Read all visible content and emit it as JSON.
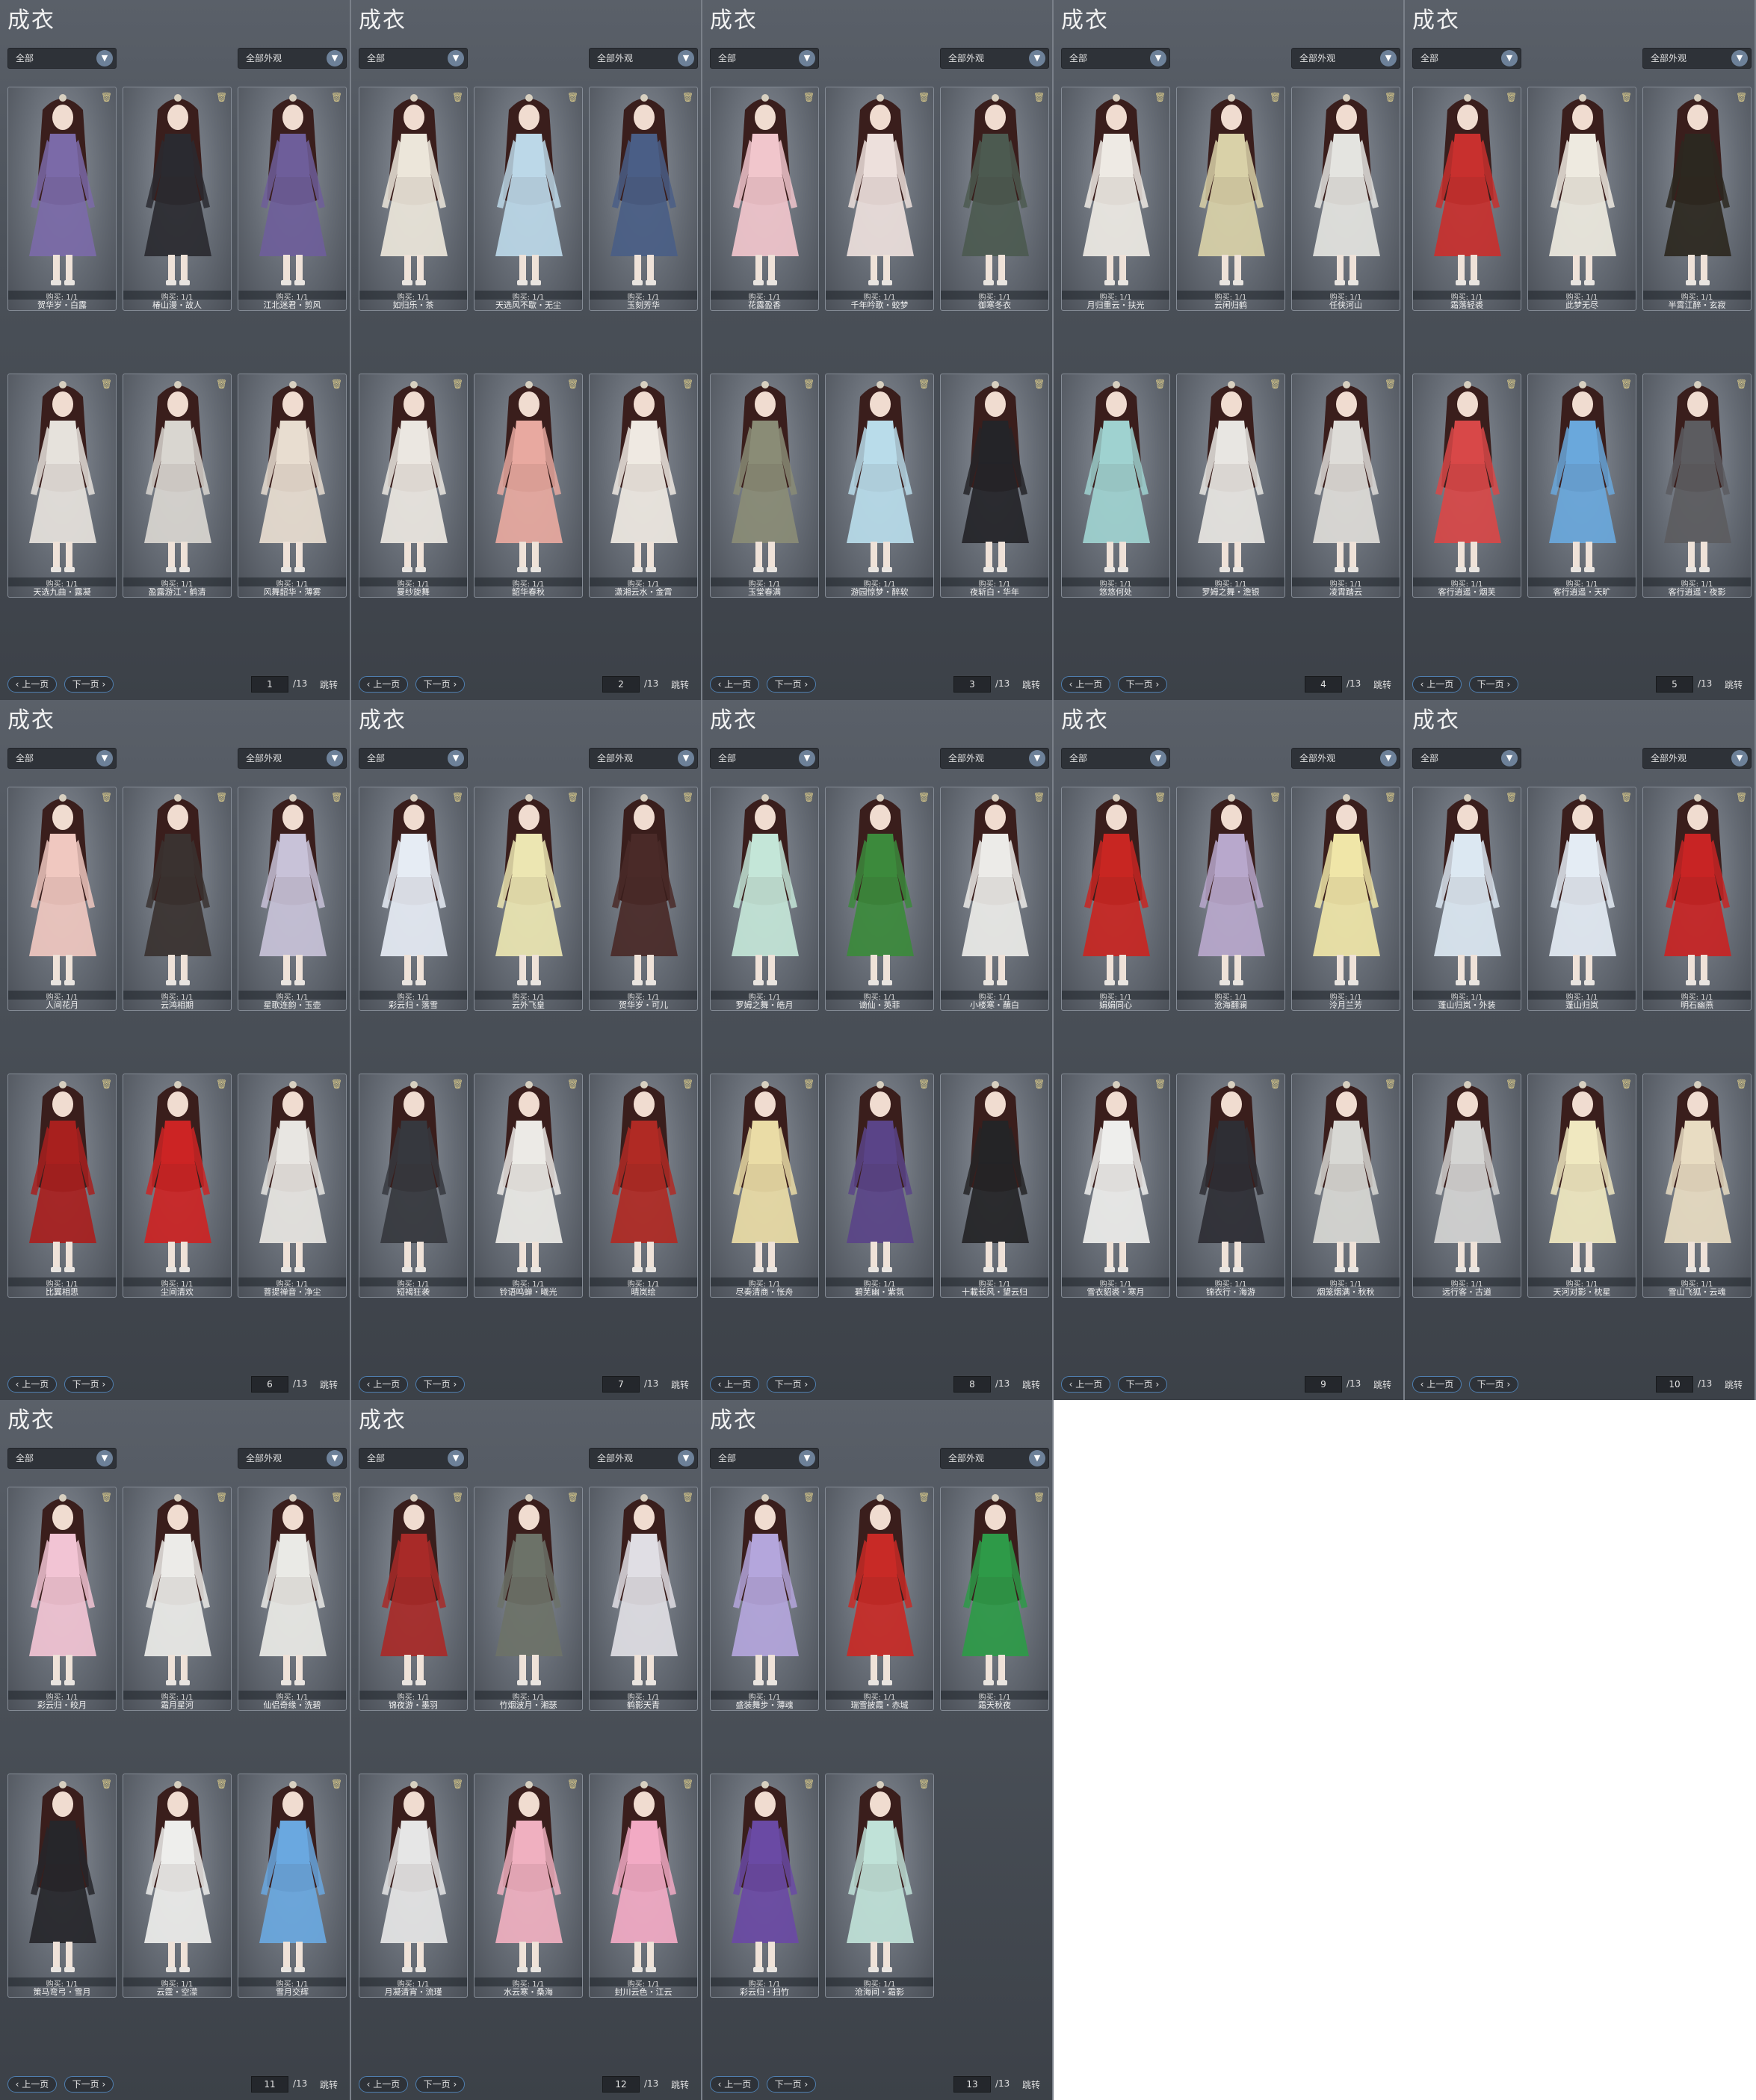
{
  "app": {
    "panel_title": "成衣",
    "filter_left": "全部",
    "filter_right": "全部外观",
    "prev_label": "上一页",
    "next_label": "下一页",
    "jump_label": "跳转",
    "total_pages": "/13"
  },
  "panels": [
    {
      "page": "1",
      "items": [
        {
          "name": "贺华岁・白露",
          "bought": "购买: 1/1",
          "color": "#7b6aa8"
        },
        {
          "name": "椿山漫・故人",
          "bought": "购买: 1/1",
          "color": "#2a2a30"
        },
        {
          "name": "江北迷君・剪风",
          "bought": "购买: 1/1",
          "color": "#6e5e9a"
        },
        {
          "name": "天选九曲・露凝",
          "bought": "购买: 1/1",
          "color": "#e6e2dc"
        },
        {
          "name": "盈露游江・鹤清",
          "bought": "购买: 1/1",
          "color": "#d9d6d0"
        },
        {
          "name": "风舞韶华・薄雾",
          "bought": "购买: 1/1",
          "color": "#e8ddd0"
        }
      ]
    },
    {
      "page": "2",
      "items": [
        {
          "name": "如归乐・茶",
          "bought": "购买: 1/1",
          "color": "#ece6da"
        },
        {
          "name": "天选风不歇・无尘",
          "bought": "购买: 1/1",
          "color": "#bcd8e8"
        },
        {
          "name": "玉刻芳华",
          "bought": "购买: 1/1",
          "color": "#4a5e86"
        },
        {
          "name": "曼纱旋舞",
          "bought": "购买: 1/1",
          "color": "#ebe7e1"
        },
        {
          "name": "韶华春秋",
          "bought": "购买: 1/1",
          "color": "#e8a9a0"
        },
        {
          "name": "潇湘云水・金霄",
          "bought": "购买: 1/1",
          "color": "#efe9e2"
        }
      ]
    },
    {
      "page": "3",
      "items": [
        {
          "name": "花露盈香",
          "bought": "购买: 1/1",
          "color": "#f1c6cc"
        },
        {
          "name": "千年吟歌・蛟梦",
          "bought": "购买: 1/1",
          "color": "#ede0dc"
        },
        {
          "name": "御寒冬衣",
          "bought": "购买: 1/1",
          "color": "#4c5a50"
        },
        {
          "name": "玉堂春满",
          "bought": "购买: 1/1",
          "color": "#8a8c76"
        },
        {
          "name": "游园惊梦・醉软",
          "bought": "购买: 1/1",
          "color": "#b9dcea"
        },
        {
          "name": "夜斩白・华年",
          "bought": "购买: 1/1",
          "color": "#242428"
        }
      ]
    },
    {
      "page": "4",
      "items": [
        {
          "name": "月归重云・扶光",
          "bought": "购买: 1/1",
          "color": "#eeeae4"
        },
        {
          "name": "云闲归鹤",
          "bought": "购买: 1/1",
          "color": "#d9d1a8"
        },
        {
          "name": "任侠河山",
          "bought": "购买: 1/1",
          "color": "#e4e4e0"
        },
        {
          "name": "悠悠何处",
          "bought": "购买: 1/1",
          "color": "#9fd2d0"
        },
        {
          "name": "罗姆之舞・澹银",
          "bought": "购买: 1/1",
          "color": "#e8e6e2"
        },
        {
          "name": "凌霄踏云",
          "bought": "购买: 1/1",
          "color": "#dedcd8"
        }
      ]
    },
    {
      "page": "5",
      "items": [
        {
          "name": "霜落轻裘",
          "bought": "购买: 1/1",
          "color": "#c8302e"
        },
        {
          "name": "此梦无尽",
          "bought": "购买: 1/1",
          "color": "#eeeae0"
        },
        {
          "name": "半霄江醉・玄寂",
          "bought": "购买: 1/1",
          "color": "#2c2820"
        },
        {
          "name": "客行逍遥・烟芙",
          "bought": "购买: 1/1",
          "color": "#d84848"
        },
        {
          "name": "客行逍遥・天旷",
          "bought": "购买: 1/1",
          "color": "#6aa8dc"
        },
        {
          "name": "客行逍遥・夜影",
          "bought": "购买: 1/1",
          "color": "#5c5c60"
        }
      ]
    },
    {
      "page": "6",
      "items": [
        {
          "name": "人间花月",
          "bought": "购买: 1/1",
          "color": "#f0c8c0"
        },
        {
          "name": "云鸿相期",
          "bought": "购买: 1/1",
          "color": "#3a3230"
        },
        {
          "name": "星歌连韵・玉壶",
          "bought": "购买: 1/1",
          "color": "#c8c2d8"
        },
        {
          "name": "比翼相思",
          "bought": "购买: 1/1",
          "color": "#a8201e"
        },
        {
          "name": "尘间清欢",
          "bought": "购买: 1/1",
          "color": "#cc2424"
        },
        {
          "name": "菩提禅音・净尘",
          "bought": "购买: 1/1",
          "color": "#e8e6e2"
        }
      ]
    },
    {
      "page": "7",
      "items": [
        {
          "name": "彩云归・落雪",
          "bought": "购买: 1/1",
          "color": "#e6ecf4"
        },
        {
          "name": "云外飞皇",
          "bought": "购买: 1/1",
          "color": "#ece6b2"
        },
        {
          "name": "贺华岁・可儿",
          "bought": "购买: 1/1",
          "color": "#4a2a28"
        },
        {
          "name": "短褐狂袭",
          "bought": "购买: 1/1",
          "color": "#36383e"
        },
        {
          "name": "铃语鸣蝉・曦光",
          "bought": "购买: 1/1",
          "color": "#eceae6"
        },
        {
          "name": "晴岚绘",
          "bought": "购买: 1/1",
          "color": "#b02a24"
        }
      ]
    },
    {
      "page": "8",
      "items": [
        {
          "name": "罗姆之舞・皓月",
          "bought": "购买: 1/1",
          "color": "#c4e6d8"
        },
        {
          "name": "谪仙・英菲",
          "bought": "购买: 1/1",
          "color": "#3c8a3c"
        },
        {
          "name": "小楼寒・蘸白",
          "bought": "购买: 1/1",
          "color": "#ecebe8"
        },
        {
          "name": "尽奏清商・怅舟",
          "bought": "购买: 1/1",
          "color": "#eadca6"
        },
        {
          "name": "碧芜幽・紫氛",
          "bought": "购买: 1/1",
          "color": "#5a4488"
        },
        {
          "name": "十載长风・望云归",
          "bought": "购买: 1/1",
          "color": "#242426"
        }
      ]
    },
    {
      "page": "9",
      "items": [
        {
          "name": "娟娟同心",
          "bought": "购买: 1/1",
          "color": "#c82622"
        },
        {
          "name": "沧海翻澜",
          "bought": "购买: 1/1",
          "color": "#b8a8cc"
        },
        {
          "name": "泠月兰芳",
          "bought": "购买: 1/1",
          "color": "#f0e6a8"
        },
        {
          "name": "雪衣貂裘・寒月",
          "bought": "购买: 1/1",
          "color": "#eeeeec"
        },
        {
          "name": "锦衣行・海游",
          "bought": "购买: 1/1",
          "color": "#2e2e34"
        },
        {
          "name": "烟笼烟满・秋秋",
          "bought": "购买: 1/1",
          "color": "#d8d8d4"
        }
      ]
    },
    {
      "page": "10",
      "items": [
        {
          "name": "蓬山归岚・外装",
          "bought": "购买: 1/1",
          "color": "#dce8f2"
        },
        {
          "name": "蓬山归岚",
          "bought": "购买: 1/1",
          "color": "#e4ecf4"
        },
        {
          "name": "明石幽燕",
          "bought": "购买: 1/1",
          "color": "#c82424"
        },
        {
          "name": "远行客・古道",
          "bought": "购买: 1/1",
          "color": "#d4d4d2"
        },
        {
          "name": "天河对影・枕星",
          "bought": "购买: 1/1",
          "color": "#f0e8c0"
        },
        {
          "name": "雪山飞狐・云魂",
          "bought": "购买: 1/1",
          "color": "#e8dcc2"
        }
      ]
    },
    {
      "page": "11",
      "items": [
        {
          "name": "彩云归・皎月",
          "bought": "购买: 1/1",
          "color": "#f2c4d4"
        },
        {
          "name": "霜月星河",
          "bought": "购买: 1/1",
          "color": "#ecebe8"
        },
        {
          "name": "仙侣奇缘・洗碧",
          "bought": "购买: 1/1",
          "color": "#eaeae6"
        },
        {
          "name": "策马弯弓・雪月",
          "bought": "购买: 1/1",
          "color": "#26262a"
        },
        {
          "name": "云霆・空濛",
          "bought": "购买: 1/1",
          "color": "#eeeeec"
        },
        {
          "name": "雪月交辉",
          "bought": "购买: 1/1",
          "color": "#6aa8e0"
        }
      ]
    },
    {
      "page": "12",
      "items": [
        {
          "name": "锦夜游・墨羽",
          "bought": "购买: 1/1",
          "color": "#a82a28"
        },
        {
          "name": "竹烟波月・湘瑟",
          "bought": "购买: 1/1",
          "color": "#6c7268"
        },
        {
          "name": "鹤影天青",
          "bought": "购买: 1/1",
          "color": "#e0dee4"
        },
        {
          "name": "月凝清宵・流瑾",
          "bought": "购买: 1/1",
          "color": "#e6e6e6"
        },
        {
          "name": "水云寒・桑海",
          "bought": "购买: 1/1",
          "color": "#f0b0c0"
        },
        {
          "name": "封川云色・江云",
          "bought": "购买: 1/1",
          "color": "#f2aac4"
        }
      ]
    },
    {
      "page": "13",
      "items": [
        {
          "name": "盛装舞步・薄魂",
          "bought": "购买: 1/1",
          "color": "#b4a6dc"
        },
        {
          "name": "瑞雪披霞・赤城",
          "bought": "购买: 1/1",
          "color": "#c82a26"
        },
        {
          "name": "霜天秋夜",
          "bought": "购买: 1/1",
          "color": "#2e9a48"
        },
        {
          "name": "彩云归・扫竹",
          "bought": "购买: 1/1",
          "color": "#6a4aa4"
        },
        {
          "name": "沧海间・霜影",
          "bought": "购买: 1/1",
          "color": "#c0e2d8"
        }
      ]
    }
  ]
}
